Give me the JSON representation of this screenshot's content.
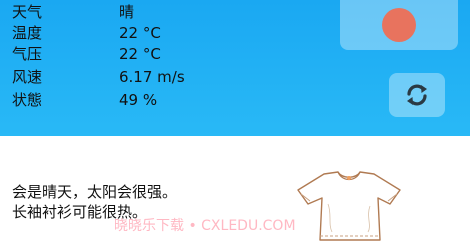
{
  "weather": {
    "rows": [
      {
        "label": "天气",
        "value": "晴"
      },
      {
        "label": "温度",
        "value": "22 °C"
      },
      {
        "label": "气压",
        "value": "22 °C"
      },
      {
        "label": "风速",
        "value": "6.17 m/s"
      },
      {
        "label": "状態",
        "value": "49 %"
      }
    ]
  },
  "indicator": {
    "color": "#e8735e"
  },
  "refresh": {
    "icon": "refresh-icon"
  },
  "advice": {
    "line1": "会是晴天，太阳会很强。",
    "line2": "长袖衬衫可能很热。"
  },
  "watermark": {
    "text": "晓晓乐下载 • CXLEDU.COM"
  },
  "illustration": {
    "icon": "t-shirt-icon"
  }
}
